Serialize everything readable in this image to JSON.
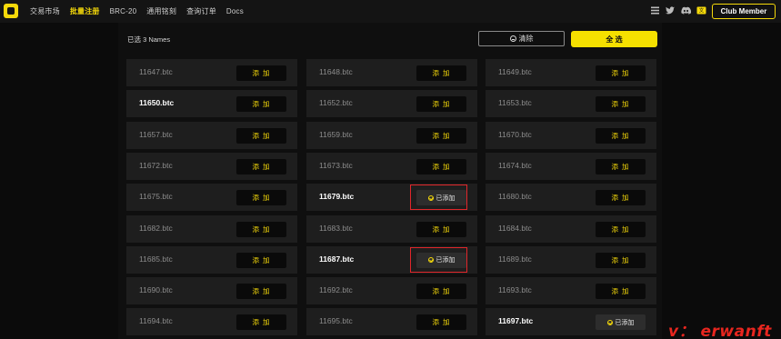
{
  "nav": {
    "items": [
      {
        "label": "交易市场",
        "active": false
      },
      {
        "label": "批量注册",
        "active": true
      },
      {
        "label": "BRC-20",
        "active": false
      },
      {
        "label": "通用铭刻",
        "active": false
      },
      {
        "label": "查询订单",
        "active": false
      },
      {
        "label": "Docs",
        "active": false
      }
    ],
    "icons": [
      "menu-icon",
      "twitter-icon",
      "discord-icon",
      "language-icon"
    ],
    "club_button": "Club Member"
  },
  "toolbar": {
    "selected_text": "已选 3 Names",
    "clear_label": "清除",
    "select_all_label": "全 选"
  },
  "colors": {
    "accent": "#f5e000",
    "cell_bg": "#1e1e1e",
    "highlight_border": "#e0262a"
  },
  "grid": {
    "add_label": "添 加",
    "added_label": "已添加",
    "rows": [
      [
        {
          "name": "11647.btc",
          "added": false
        },
        {
          "name": "11648.btc",
          "added": false
        },
        {
          "name": "11649.btc",
          "added": false
        }
      ],
      [
        {
          "name": "11650.btc",
          "added": false,
          "highlight": true
        },
        {
          "name": "11652.btc",
          "added": false
        },
        {
          "name": "11653.btc",
          "added": false
        }
      ],
      [
        {
          "name": "11657.btc",
          "added": false
        },
        {
          "name": "11659.btc",
          "added": false
        },
        {
          "name": "11670.btc",
          "added": false
        }
      ],
      [
        {
          "name": "11672.btc",
          "added": false
        },
        {
          "name": "11673.btc",
          "added": false
        },
        {
          "name": "11674.btc",
          "added": false
        }
      ],
      [
        {
          "name": "11675.btc",
          "added": false
        },
        {
          "name": "11679.btc",
          "added": true,
          "highlight": true
        },
        {
          "name": "11680.btc",
          "added": false
        }
      ],
      [
        {
          "name": "11682.btc",
          "added": false
        },
        {
          "name": "11683.btc",
          "added": false
        },
        {
          "name": "11684.btc",
          "added": false
        }
      ],
      [
        {
          "name": "11685.btc",
          "added": false
        },
        {
          "name": "11687.btc",
          "added": true,
          "highlight": true
        },
        {
          "name": "11689.btc",
          "added": false
        }
      ],
      [
        {
          "name": "11690.btc",
          "added": false
        },
        {
          "name": "11692.btc",
          "added": false
        },
        {
          "name": "11693.btc",
          "added": false
        }
      ],
      [
        {
          "name": "11694.btc",
          "added": false
        },
        {
          "name": "11695.btc",
          "added": false
        },
        {
          "name": "11697.btc",
          "added": true,
          "highlight": true
        }
      ]
    ]
  },
  "watermark": "v： erwanft"
}
